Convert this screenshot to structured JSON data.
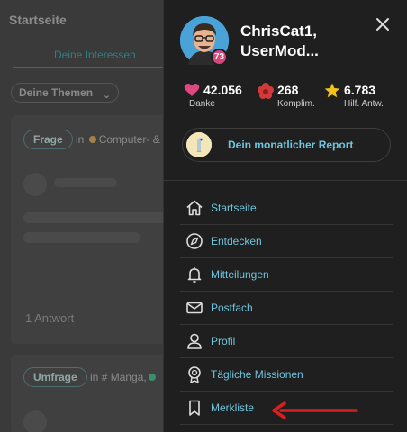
{
  "background": {
    "title": "Startseite",
    "tab_label": "Deine Interessen",
    "filter_label": "Deine Themen",
    "card1": {
      "chip": "Frage",
      "in_prefix": "in",
      "topic": "Computer- &",
      "answers": "1 Antwort"
    },
    "card2": {
      "chip": "Umfrage",
      "in_prefix": "in",
      "topic": "# Manga,",
      "topic_color": "#3b8d6b"
    }
  },
  "profile": {
    "username_line1": "ChrisCat1,",
    "username_line2": "UserMod...",
    "level": "73"
  },
  "stats": [
    {
      "value": "42.056",
      "label": "Danke",
      "icon": "heart-icon",
      "color": "#e0467f"
    },
    {
      "value": "268",
      "label": "Komplim.",
      "icon": "flower-icon",
      "color": "#d23a3a"
    },
    {
      "value": "6.783",
      "label": "Hilf. Antw.",
      "icon": "star-icon",
      "color": "#f2c21b"
    }
  ],
  "report": {
    "label": "Dein monatlicher Report"
  },
  "menu": [
    {
      "label": "Startseite",
      "icon": "home-icon"
    },
    {
      "label": "Entdecken",
      "icon": "compass-icon"
    },
    {
      "label": "Mitteilungen",
      "icon": "bell-icon"
    },
    {
      "label": "Postfach",
      "icon": "mail-icon"
    },
    {
      "label": "Profil",
      "icon": "person-icon"
    },
    {
      "label": "Tägliche Missionen",
      "icon": "medal-icon"
    },
    {
      "label": "Merkliste",
      "icon": "bookmark-icon"
    }
  ],
  "colors": {
    "accent": "#6fc4de",
    "annotation_arrow": "#d81f1f",
    "drawer_bg": "#1f1f1f"
  }
}
